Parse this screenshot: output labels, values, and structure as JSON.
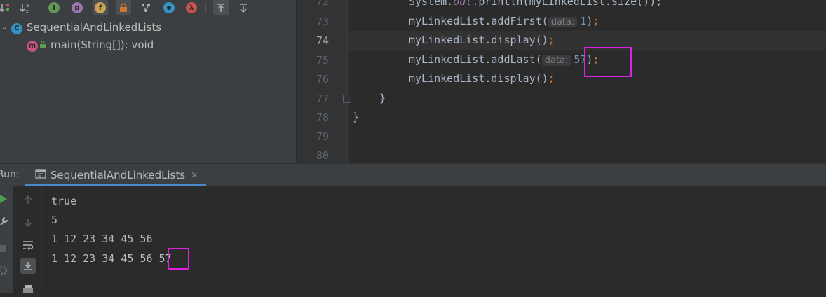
{
  "structure": {
    "toolbar_icons": [
      {
        "name": "sort-visibility-icon",
        "glyph": "↓"
      },
      {
        "name": "sort-alpha-icon",
        "glyph": "a z"
      },
      {
        "name": "show-inherited-icon",
        "glyph": "I",
        "color": "#629755"
      },
      {
        "name": "show-properties-icon",
        "glyph": "p",
        "color": "#9876aa"
      },
      {
        "name": "show-fields-icon",
        "glyph": "f",
        "color": "#c7a450"
      },
      {
        "name": "show-non-public-icon",
        "glyph": "●",
        "color": "#cc7832"
      },
      {
        "name": "show-anonymous-icon",
        "glyph": "⑂"
      },
      {
        "name": "show-lambdas-icon",
        "glyph": "●",
        "color": "#3592c4"
      },
      {
        "name": "show-lambda-icon",
        "glyph": "λ",
        "color": "#c75450"
      },
      {
        "name": "autoscroll-to-source-icon",
        "glyph": "⤒"
      },
      {
        "name": "autoscroll-from-source-icon",
        "glyph": "⤓"
      }
    ],
    "class_node": {
      "icon_letter": "C",
      "label": "SequentialAndLinkedLists"
    },
    "method_node": {
      "icon_letter": "m",
      "label": "main(String[]): void"
    }
  },
  "editor": {
    "line_numbers": [
      "72",
      "73",
      "74",
      "75",
      "76",
      "77",
      "78",
      "79",
      "80"
    ],
    "current_line": "74",
    "lines": {
      "l72": {
        "prefix": "System.",
        "static": "out",
        "rest": ".println(myLinkedList.size());"
      },
      "l73": {
        "call": "myLinkedList.addFirst(",
        "hint": "data:",
        "arg": "1",
        "tail": ")",
        "semi": ";"
      },
      "l74": {
        "call": "myLinkedList.display()",
        "semi": ";"
      },
      "l75": {
        "call": "myLinkedList.addLast(",
        "hint": "data:",
        "arg": "57",
        "tail": ")",
        "semi": ";"
      },
      "l76": {
        "call": "myLinkedList.display()",
        "semi": ";"
      },
      "l77": {
        "text": "}"
      },
      "l78": {
        "text": "}"
      }
    }
  },
  "run": {
    "label": "Run:",
    "tab_title": "SequentialAndLinkedLists",
    "close_glyph": "✕",
    "output": [
      "true",
      "5",
      "1 12 23 34 45 56",
      "1 12 23 34 45 56 "
    ],
    "output_highlight": "57"
  },
  "colors": {
    "highlight": "#e020e0",
    "accent": "#4a88c7"
  }
}
